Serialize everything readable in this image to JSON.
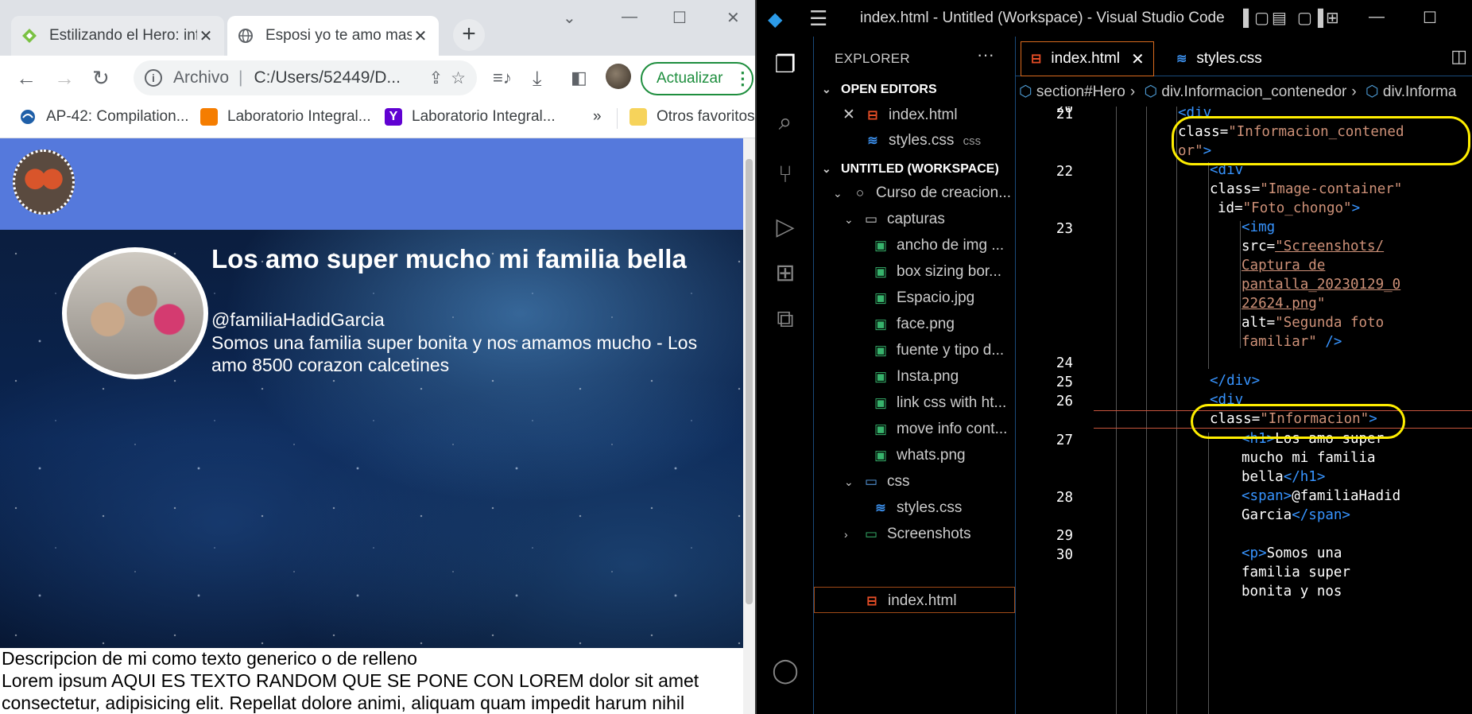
{
  "chrome": {
    "tabs": [
      {
        "title": "Estilizando el Hero: inf",
        "favicon": "green-diamond-icon"
      },
      {
        "title": "Esposi yo te amo mas",
        "favicon": "globe-icon"
      }
    ],
    "omnibox": {
      "scheme": "Archivo",
      "separator": "|",
      "url": "C:/Users/52449/D..."
    },
    "update_label": "Actualizar",
    "bookmarks": [
      {
        "label": "AP-42: Compilation...",
        "icon": "epa-icon"
      },
      {
        "label": "Laboratorio Integral...",
        "icon": "blogger-icon"
      },
      {
        "label": "Laboratorio Integral...",
        "icon": "yahoo-icon"
      },
      {
        "label": "Otros favoritos",
        "icon": "folder-icon"
      }
    ],
    "bookmarks_more": "»"
  },
  "page": {
    "hero_title": "Los amo super mucho mi familia bella",
    "hero_handle": "@familiaHadidGarcia",
    "hero_desc": "Somos una familia super bonita y nos amamos mucho - Los amo 8500 corazon calcetines",
    "body_line1": "Descripcion de mi como texto generico o de relleno",
    "body_line2": "Lorem ipsum AQUI ES TEXTO RANDOM QUE SE PONE CON LOREM dolor sit amet consectetur, adipisicing elit. Repellat dolore animi, aliquam quam impedit harum nihil"
  },
  "vscode": {
    "title": "index.html - Untitled (Workspace) - Visual Studio Code",
    "explorer_header": "EXPLORER",
    "open_editors_header": "OPEN EDITORS",
    "workspace_header": "UNTITLED (WORKSPACE)",
    "open_editors": [
      {
        "name": "index.html",
        "detail": ""
      },
      {
        "name": "styles.css",
        "detail": "css"
      }
    ],
    "tree": [
      {
        "label": "Curso de creacion...",
        "kind": "folder-root"
      },
      {
        "label": "capturas",
        "kind": "folder"
      },
      {
        "label": "ancho de img ...",
        "kind": "png"
      },
      {
        "label": "box sizing bor...",
        "kind": "png"
      },
      {
        "label": "Espacio.jpg",
        "kind": "png"
      },
      {
        "label": "face.png",
        "kind": "png"
      },
      {
        "label": "fuente y tipo d...",
        "kind": "png"
      },
      {
        "label": "Insta.png",
        "kind": "png"
      },
      {
        "label": "link css with ht...",
        "kind": "png"
      },
      {
        "label": "move info cont...",
        "kind": "png"
      },
      {
        "label": "whats.png",
        "kind": "png"
      },
      {
        "label": "css",
        "kind": "folder-blue"
      },
      {
        "label": "styles.css",
        "kind": "css"
      },
      {
        "label": "Screenshots",
        "kind": "folder-green"
      },
      {
        "label": "index.html",
        "kind": "html"
      }
    ],
    "editor_tabs": [
      "index.html",
      "styles.css"
    ],
    "breadcrumbs": [
      "section#Hero",
      "div.Informacion_contenedor",
      "div.Informa"
    ],
    "line_numbers": [
      "20",
      "21",
      "22",
      "23",
      "24",
      "25",
      "26",
      "27",
      "28",
      "29",
      "30"
    ]
  }
}
